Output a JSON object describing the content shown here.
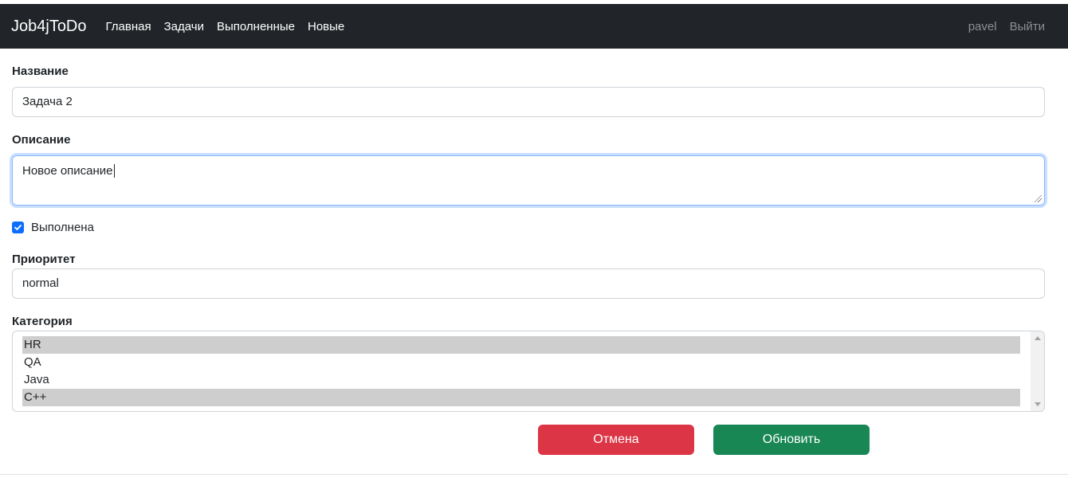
{
  "navbar": {
    "brand": "Job4jToDo",
    "links": [
      "Главная",
      "Задачи",
      "Выполненные",
      "Новые"
    ],
    "user": "pavel",
    "logout": "Выйти"
  },
  "form": {
    "name_label": "Название",
    "name_value": "Задача 2",
    "description_label": "Описание",
    "description_value": "Новое описание",
    "done_label": "Выполнена",
    "done_checked": true,
    "priority_label": "Приоритет",
    "priority_value": "normal",
    "category_label": "Категория",
    "categories": [
      {
        "label": "HR",
        "selected": true
      },
      {
        "label": "QA",
        "selected": false
      },
      {
        "label": "Java",
        "selected": false
      },
      {
        "label": "C++",
        "selected": true
      }
    ],
    "cancel_label": "Отмена",
    "update_label": "Обновить"
  },
  "colors": {
    "navbar_bg": "#212529",
    "checkbox": "#0d6efd",
    "cancel": "#dc3545",
    "update": "#198754",
    "selected_option": "#cecece"
  }
}
